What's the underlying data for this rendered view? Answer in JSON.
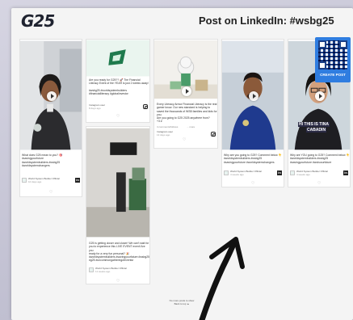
{
  "header": {
    "logo": "G25",
    "title": "Post on LinkedIn: #wsbg25"
  },
  "posts": [
    {
      "caption": "What does G25 mean to you? 🎯\n#savingyourfuture\n#worldsystembuilders #wsbg25\n#worldsystemchangers",
      "author": "World System Builder Official",
      "time": "10 days ago",
      "network": "linkedin"
    },
    {
      "caption": "Are you ready for G25?? 🚀 The Financial\nLiteracy Event of the YEAR is just 2 weeks away!\n\n#wsbg25 #worldsystembuilders\n#financialliteracy #globalinvestor",
      "author": "Instagram user",
      "time": "8 days ago",
      "network": "instagram"
    },
    {
      "caption": "G25 is getting closer and closer! We can't wait for\nyou to experience this LIVE EVENT event! Are you\nready for a very fun personal? 🎉\n#worldsystembuilders #savingyourfuture #wsbg25\n#g25 #uncommongatheringofeventsr",
      "author": "World System Builder Official",
      "time": "11 weeks ago",
      "network": "linkedin"
    },
    {
      "caption": "Every Literacy Armor Financial Literacy is the real\ngamer know. Our new standard is helping to\nsaved the thousands of WSB families and kids for you.\nAre you going to G25 2025 anywhere from?\n+3 #",
      "comments": "4 comments/follows",
      "more": "... more",
      "author": "Instagram user",
      "time": "13 days ago",
      "network": "instagram"
    },
    {
      "caption": "Why are you going to G25? Comment below 👇\n#worldsystembuilders #wsbg25\n#savingyourfuture #worldsystemchangers",
      "author": "World System Builder Official",
      "time": "4 weeks ago",
      "network": "linkedin"
    },
    {
      "caption": "Why are YOU going to G25? Comment below 👇\n#worldsystembuilders #wsbg25\n#savingyourfuture #wsbuourfuture",
      "author": "World System Builder Official",
      "time": "4 weeks ago",
      "network": "linkedin",
      "overlay": "HI THIS IS TINA",
      "overlay2": "CABADIN"
    }
  ],
  "qr": {
    "label": "CREATE POST"
  },
  "footer": {
    "line1": "No more posts to show",
    "line2": "Back to top ▲"
  },
  "icons": {
    "heart": "♡",
    "linkedin": "in",
    "like_count": "0"
  }
}
